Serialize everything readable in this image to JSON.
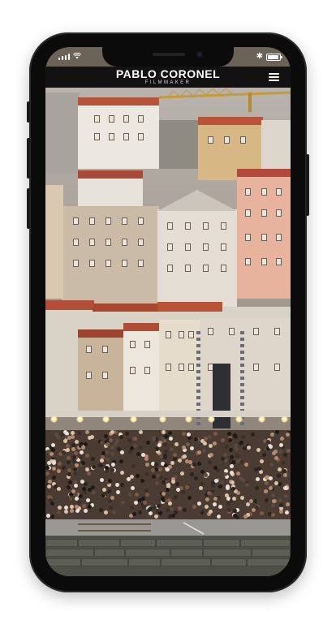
{
  "brand": {
    "title": "PABLO CORONEL",
    "subtitle": "FILMMAKER"
  },
  "header": {
    "menu_icon": "hamburger-menu-icon"
  },
  "status_bar": {
    "icons": [
      "signal-icon",
      "wifi-icon",
      "bluetooth-icon",
      "battery-icon"
    ],
    "battery_level": 0.9
  },
  "colors": {
    "header_bg": "#121212",
    "phone_body": "#0b0b0b",
    "text": "#ffffff"
  }
}
